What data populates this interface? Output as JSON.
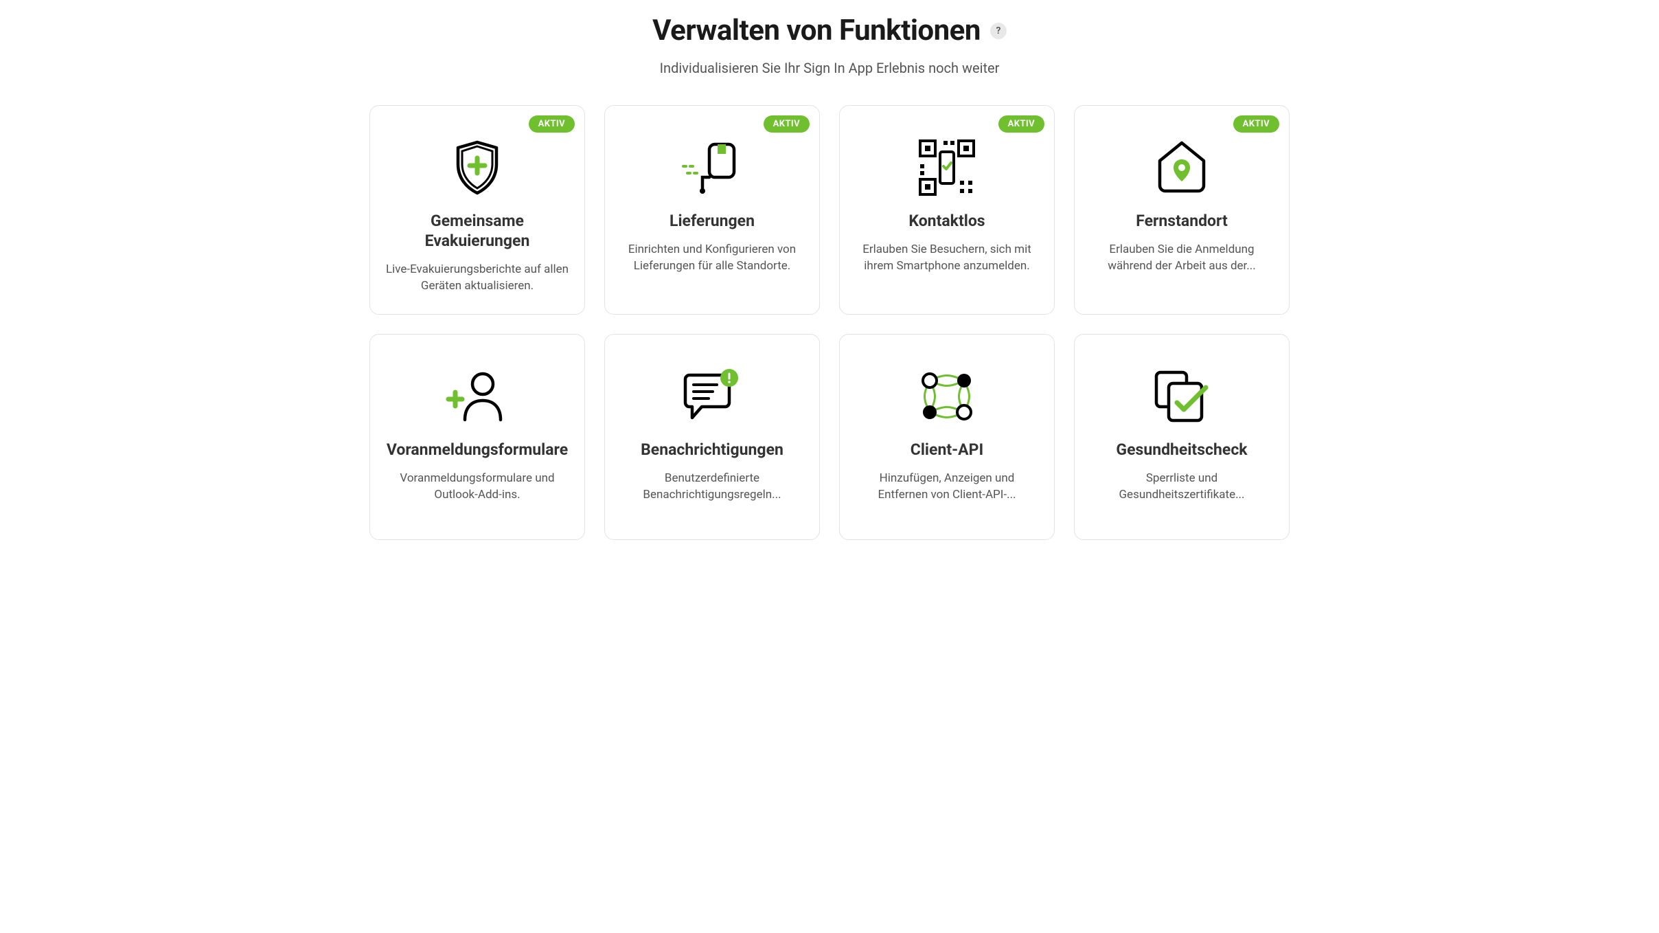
{
  "header": {
    "title": "Verwalten von Funktionen",
    "help_icon_label": "?",
    "subtitle": "Individualisieren Sie Ihr Sign In App Erlebnis noch weiter"
  },
  "active_label": "AKTIV",
  "cards": [
    {
      "id": "shared-evacuations",
      "icon": "shield-plus-icon",
      "title": "Gemeinsame Evakuierungen",
      "desc": "Live-Evakuierungsberichte auf allen Geräten aktualisieren.",
      "active": true
    },
    {
      "id": "deliveries",
      "icon": "delivery-trolley-icon",
      "title": "Lieferungen",
      "desc": "Einrichten und Konfigurieren von Lieferungen für alle Standorte.",
      "active": true
    },
    {
      "id": "contactless",
      "icon": "qr-code-icon",
      "title": "Kontaktlos",
      "desc": "Erlauben Sie Besuchern, sich mit ihrem Smartphone anzumelden.",
      "active": true
    },
    {
      "id": "remote-site",
      "icon": "house-pin-icon",
      "title": "Fernstandort",
      "desc": "Erlauben Sie die Anmeldung während der Arbeit aus der...",
      "active": true
    },
    {
      "id": "preregistration-forms",
      "icon": "person-plus-icon",
      "title": "Voranmeldungsformulare",
      "desc": "Voranmeldungsformulare und Outlook-Add-ins.",
      "active": false
    },
    {
      "id": "notifications",
      "icon": "chat-alert-icon",
      "title": "Benachrichtigungen",
      "desc": "Benutzerdefinierte Benachrichtigungsregeln...",
      "active": false
    },
    {
      "id": "client-api",
      "icon": "network-nodes-icon",
      "title": "Client-API",
      "desc": "Hinzufügen, Anzeigen und Entfernen von Client-API-...",
      "active": false
    },
    {
      "id": "health-check",
      "icon": "clipboard-check-icon",
      "title": "Gesundheitscheck",
      "desc": "Sperrliste und Gesundheitszertifikate...",
      "active": false
    }
  ]
}
